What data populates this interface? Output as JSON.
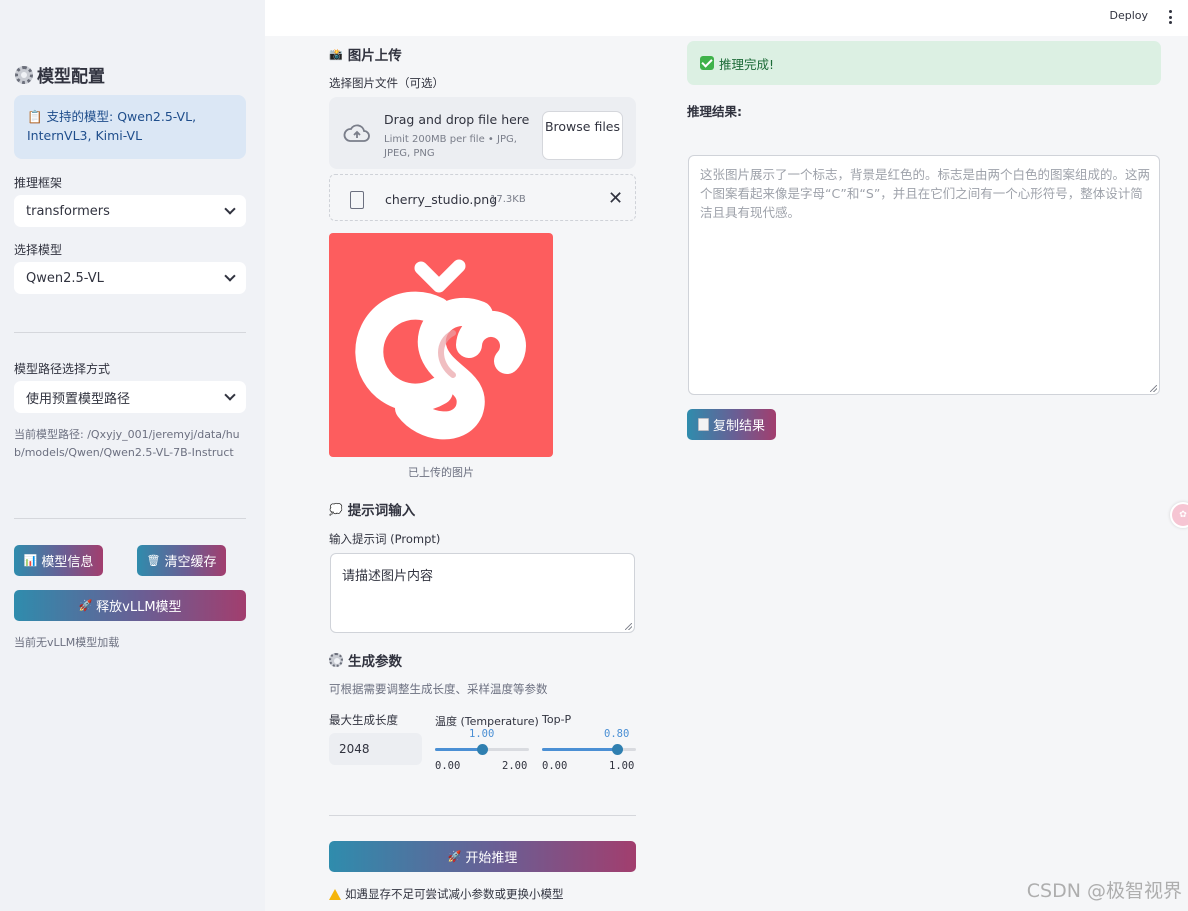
{
  "sidebar": {
    "title": "模型配置",
    "info": "📋 支持的模型: Qwen2.5-VL, InternVL3, Kimi-VL",
    "framework_label": "推理框架",
    "framework_value": "transformers",
    "model_label": "选择模型",
    "model_value": "Qwen2.5-VL",
    "path_mode_label": "模型路径选择方式",
    "path_mode_value": "使用预置模型路径",
    "path_text": "当前模型路径: /Qxyjy_001/jeremyj/data/hub/models/Qwen/Qwen2.5-VL-7B-Instruct",
    "model_info_btn": "模型信息",
    "clear_cache_btn": "清空缓存",
    "release_btn": "释放vLLM模型",
    "status_note": "当前无vLLM模型加载"
  },
  "header": {
    "deploy": "Deploy"
  },
  "upload": {
    "heading": "图片上传",
    "label": "选择图片文件（可选）",
    "drop_title": "Drag and drop file here",
    "drop_sub": "Limit 200MB per file • JPG, JPEG, PNG",
    "browse_label": "Browse files",
    "file_name": "cherry_studio.png",
    "file_size": "17.3KB",
    "caption": "已上传的图片"
  },
  "prompt": {
    "heading": "提示词输入",
    "label": "输入提示词 (Prompt)",
    "value": "请描述图片内容"
  },
  "params": {
    "heading": "生成参数",
    "desc": "可根据需要调整生成长度、采样温度等参数",
    "max_len_label": "最大生成长度",
    "max_len_value": "2048",
    "temp_label": "温度 (Temperature)",
    "temp_value": "1.00",
    "temp_min": "0.00",
    "temp_max": "2.00",
    "temp_fraction": 0.5,
    "topp_label": "Top-P",
    "topp_value": "0.80",
    "topp_min": "0.00",
    "topp_max": "1.00",
    "topp_fraction": 0.8
  },
  "actions": {
    "start_btn": "开始推理",
    "warning": "如遇显存不足可尝试减小参数或更换小模型"
  },
  "result": {
    "success": "推理完成!",
    "label": "推理结果:",
    "text": "这张图片展示了一个标志，背景是红色的。标志是由两个白色的图案组成的。这两个图案看起来像是字母“C”和“S”，并且在它们之间有一个心形符号，整体设计简洁且具有现代感。",
    "copy_btn": "复制结果"
  },
  "watermark": "CSDN @极智视界",
  "colors": {
    "accent_gradient_start": "#2f8cad",
    "accent_gradient_end": "#a23e6e",
    "logo_bg": "#fd5d5e",
    "slider_blue": "#4a8fd4"
  }
}
